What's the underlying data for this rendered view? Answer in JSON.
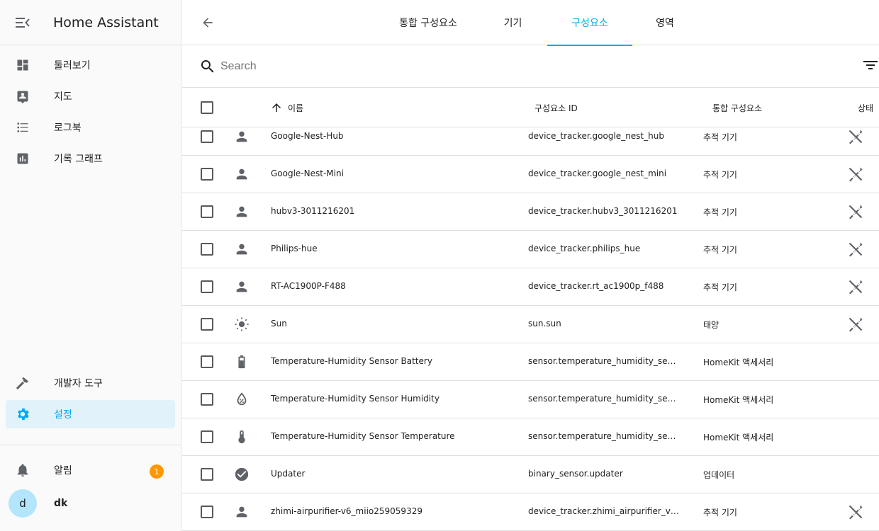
{
  "app": {
    "title": "Home Assistant"
  },
  "sidebar": {
    "items": [
      {
        "label": "둘러보기",
        "icon": "dashboard-icon"
      },
      {
        "label": "지도",
        "icon": "map-account-icon"
      },
      {
        "label": "로그북",
        "icon": "logbook-list-icon"
      },
      {
        "label": "기록 그래프",
        "icon": "history-chart-icon"
      }
    ],
    "bottom_items": [
      {
        "label": "개발자 도구",
        "icon": "hammer-icon"
      },
      {
        "label": "설정",
        "icon": "gear-icon",
        "active": true
      }
    ],
    "notifications": {
      "label": "알림",
      "count": "1"
    },
    "user": {
      "initial": "d",
      "name": "dk"
    }
  },
  "tabs": [
    {
      "label": "통합 구성요소"
    },
    {
      "label": "기기"
    },
    {
      "label": "구성요소",
      "active": true
    },
    {
      "label": "영역"
    }
  ],
  "search": {
    "placeholder": "Search"
  },
  "table": {
    "headers": {
      "name": "이름",
      "entity_id": "구성요소 ID",
      "integration": "통합 구성요소",
      "status": "상태"
    },
    "sort": "ascending",
    "rows": [
      {
        "name": "Google-Nest-Hub",
        "entity_id": "device_tracker.google_nest_hub",
        "integration": "추적 기기",
        "icon": "account-icon",
        "status": "unavailable-icon"
      },
      {
        "name": "Google-Nest-Mini",
        "entity_id": "device_tracker.google_nest_mini",
        "integration": "추적 기기",
        "icon": "account-icon",
        "status": "unavailable-icon"
      },
      {
        "name": "hubv3-3011216201",
        "entity_id": "device_tracker.hubv3_3011216201",
        "integration": "추적 기기",
        "icon": "account-icon",
        "status": "unavailable-icon"
      },
      {
        "name": "Philips-hue",
        "entity_id": "device_tracker.philips_hue",
        "integration": "추적 기기",
        "icon": "account-icon",
        "status": "unavailable-icon"
      },
      {
        "name": "RT-AC1900P-F488",
        "entity_id": "device_tracker.rt_ac1900p_f488",
        "integration": "추적 기기",
        "icon": "account-icon",
        "status": "unavailable-icon"
      },
      {
        "name": "Sun",
        "entity_id": "sun.sun",
        "integration": "태양",
        "icon": "sun-icon",
        "status": "unavailable-icon"
      },
      {
        "name": "Temperature-Humidity Sensor Battery",
        "entity_id": "sensor.temperature_humidity_senso…",
        "integration": "HomeKit 액세서리",
        "icon": "battery-icon",
        "status": ""
      },
      {
        "name": "Temperature-Humidity Sensor Humidity",
        "entity_id": "sensor.temperature_humidity_senso…",
        "integration": "HomeKit 액세서리",
        "icon": "water-percent-icon",
        "status": ""
      },
      {
        "name": "Temperature-Humidity Sensor Temperature",
        "entity_id": "sensor.temperature_humidity_senso…",
        "integration": "HomeKit 액세서리",
        "icon": "thermometer-icon",
        "status": ""
      },
      {
        "name": "Updater",
        "entity_id": "binary_sensor.updater",
        "integration": "업데이터",
        "icon": "check-circle-icon",
        "status": ""
      },
      {
        "name": "zhimi-airpurifier-v6_miio259059329",
        "entity_id": "device_tracker.zhimi_airpurifier_v6_…",
        "integration": "추적 기기",
        "icon": "account-icon",
        "status": "unavailable-icon"
      }
    ]
  },
  "colors": {
    "accent": "#03a9f4",
    "icon": "#5f6368",
    "badge": "#ff9800",
    "active_bg": "#e1f2fb"
  }
}
